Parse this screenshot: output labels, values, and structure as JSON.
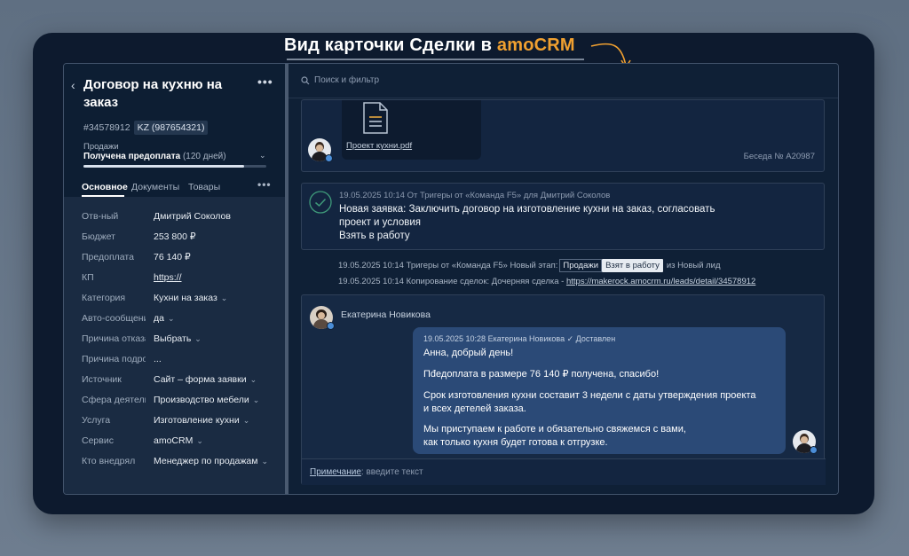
{
  "headline": {
    "prefix": "Вид карточки Сделки в",
    "brand": "amoCRM"
  },
  "deal": {
    "title": "Договор на кухню на заказ",
    "id": "#34578912",
    "kz_tag": "KZ (987654321)",
    "pipeline": "Продажи",
    "stage": "Получена предоплата",
    "stage_days": "(120 дней)",
    "stage_progress": 0.88
  },
  "tabs": [
    {
      "label": "Основное",
      "active": true
    },
    {
      "label": "Документы",
      "active": false
    },
    {
      "label": "Товары",
      "active": false
    }
  ],
  "fields": [
    {
      "label": "Отв-ный",
      "value": "Дмитрий Соколов",
      "dropdown": false,
      "link": false
    },
    {
      "label": "Бюджет",
      "value": "253 800 ₽",
      "dropdown": false,
      "link": false
    },
    {
      "label": "Предоплата",
      "value": "76 140 ₽",
      "dropdown": false,
      "link": false
    },
    {
      "label": "КП",
      "value": "https://",
      "dropdown": false,
      "link": true
    },
    {
      "label": "Категория",
      "value": "Кухни на заказ",
      "dropdown": true,
      "link": false
    },
    {
      "label": "Авто-сообщения",
      "value": "да",
      "dropdown": true,
      "link": false
    },
    {
      "label": "Причина отказа",
      "value": "Выбрать",
      "dropdown": true,
      "link": false
    },
    {
      "label": "Причина подроб",
      "value": "...",
      "dropdown": false,
      "link": false
    },
    {
      "label": "Источник",
      "value": "Сайт – форма заявки",
      "dropdown": true,
      "link": false
    },
    {
      "label": "Сфера деятельности",
      "value": "Производство мебели",
      "dropdown": true,
      "link": false
    },
    {
      "label": "Услуга",
      "value": "Изготовление кухни",
      "dropdown": true,
      "link": false
    },
    {
      "label": "Сервис",
      "value": "amoCRM",
      "dropdown": true,
      "link": false
    },
    {
      "label": "Кто внедрял",
      "value": "Менеджер по продажам",
      "dropdown": true,
      "link": false
    }
  ],
  "feed": {
    "search_placeholder": "Поиск и фильтр",
    "file": {
      "name": "Проект кухни.pdf"
    },
    "chat_label": "Беседа № A20987",
    "event": {
      "meta": "19.05.2025 10:14  От Тригеры от «Команда F5» для Дмитрий Соколов",
      "lines": [
        "Новая заявка: Заключить договор на изготовление кухни на заказ, согласовать",
        "проект и условия",
        "Взять в работу"
      ]
    },
    "system1": {
      "prefix": "19.05.2025 10:14  Тригеры от «Команда F5» Новый этап:",
      "chip1": "Продажи",
      "chip2": "Взят в работу",
      "suffix": "из Новый лид"
    },
    "system2": {
      "prefix": "19.05.2025 10:14  Копирование сделок: Дочерняя сделка -",
      "link": "https://makerock.amocrm.ru/leads/detail/34578912"
    },
    "message": {
      "sender": "Екатерина Новикова",
      "meta": "19.05.2025 10:28  Екатерина Новикова  ✓ Доставлен",
      "paragraphs": [
        [
          "Анна, добрый день!"
        ],
        [
          "Пđедоплата в размере 76 140 ₽ получена, спасибо!"
        ],
        [
          "Срок изготовления кухни составит 3 недели с даты утверждения проекта",
          "и всех детелей заказа."
        ],
        [
          "Мы приступаем к работе и обязательно свяжемся с вами,",
          "как только кухня будет готова к отгрузке."
        ]
      ]
    },
    "note": {
      "label": "Примечание",
      "placeholder": ": введите текст"
    }
  },
  "colors": {
    "accent": "#f0a030",
    "bubble": "#2b4a77",
    "frame": "#0d1a2e"
  }
}
